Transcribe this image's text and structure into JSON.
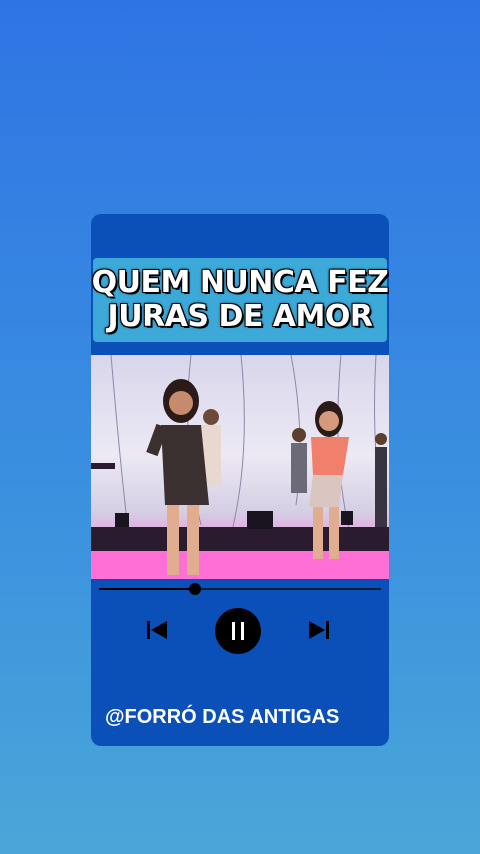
{
  "title": {
    "line1": "QUEM NUNCA FEZ",
    "line2": "JURAS DE AMOR"
  },
  "player": {
    "progress_fraction": 0.34,
    "state": "playing",
    "icons": {
      "previous": "skip-previous-icon",
      "pause": "pause-icon",
      "next": "skip-next-icon"
    }
  },
  "handle": "@FORRÓ DAS ANTIGAS",
  "colors": {
    "background_top": "#2f74e4",
    "background_bottom": "#4aa6d8",
    "card": "#0a50b8",
    "title_box": "#3ca9d9",
    "stage_light": "#ff5fd0"
  }
}
